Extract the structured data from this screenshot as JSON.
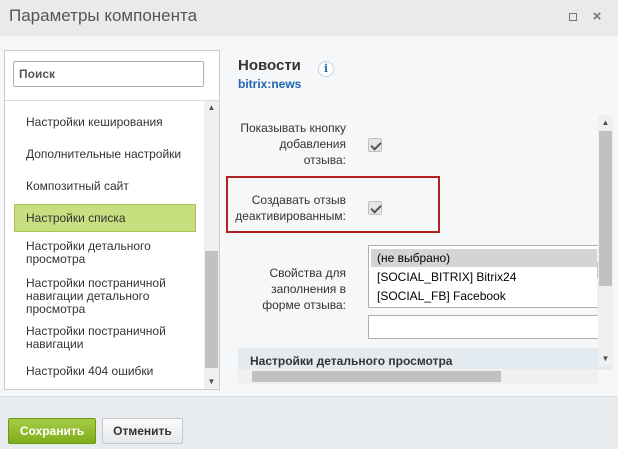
{
  "window": {
    "title": "Параметры компонента",
    "maximize_icon": "maximize-icon",
    "close_icon": "close-icon",
    "close_glyph": "×"
  },
  "sidebar": {
    "search_placeholder": "Поиск",
    "items": [
      {
        "label": "Настройки кеширования",
        "active": false
      },
      {
        "label": "Дополнительные настройки",
        "active": false
      },
      {
        "label": "Композитный сайт",
        "active": false
      },
      {
        "label": "Настройки списка",
        "active": true
      },
      {
        "label": "Настройки детального просмотра",
        "active": false
      },
      {
        "label": "Настройки постраничной навигации детального просмотра",
        "active": false
      },
      {
        "label": "Настройки постраничной навигации",
        "active": false
      },
      {
        "label": "Настройки 404 ошибки",
        "active": false
      }
    ]
  },
  "component": {
    "name": "Новости",
    "code": "bitrix:news",
    "info_glyph": "i"
  },
  "settings": {
    "show_add_button": {
      "label": "Показывать кнопку добавления отзыва:",
      "checked": true
    },
    "create_inactive": {
      "label": "Создавать отзыв деактивированным:",
      "checked": true
    },
    "properties": {
      "label": "Свойства для заполнения в форме отзыва:",
      "options": [
        "(не выбрано)",
        "[SOCIAL_BITRIX] Bitrix24",
        "[SOCIAL_FB] Facebook"
      ],
      "selected_index": 0,
      "extra_value": ""
    },
    "section_header": "Настройки детального просмотра"
  },
  "footer": {
    "save_label": "Сохранить",
    "cancel_label": "Отменить"
  },
  "colors": {
    "save_button": "#8ab62a",
    "active_item": "#c7df7f",
    "highlight_border": "#b22222",
    "component_code": "#2066b0"
  }
}
